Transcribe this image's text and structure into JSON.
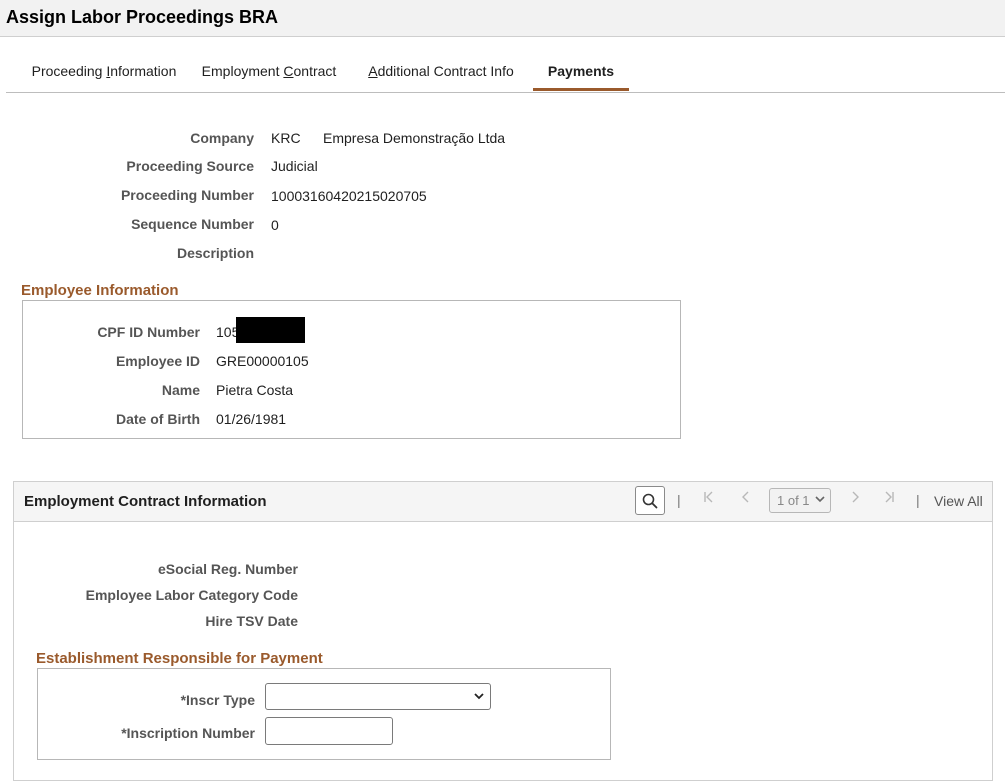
{
  "page": {
    "title": "Assign Labor Proceedings BRA"
  },
  "tabs": [
    {
      "label": "Proceeding Information",
      "accesskey_letter": "I",
      "active": false
    },
    {
      "label": "Employment Contract",
      "accesskey_letter": "C",
      "active": false
    },
    {
      "label": "Additional Contract Info",
      "accesskey_letter": "A",
      "active": false
    },
    {
      "label": "Payments",
      "active": true
    }
  ],
  "proceeding": {
    "company_label": "Company",
    "company_code": "KRC",
    "company_name": "Empresa Demonstração Ltda",
    "source_label": "Proceeding Source",
    "source_value": "Judicial",
    "number_label": "Proceeding Number",
    "number_value": "10003160420215020705",
    "sequence_label": "Sequence Number",
    "sequence_value": "0",
    "description_label": "Description",
    "description_value": ""
  },
  "employee": {
    "section_title": "Employee Information",
    "cpf_label": "CPF ID Number",
    "cpf_value_visible": "105",
    "employee_id_label": "Employee ID",
    "employee_id_value": "GRE00000105",
    "name_label": "Name",
    "name_value": "Pietra Costa",
    "dob_label": "Date of Birth",
    "dob_value": "01/26/1981"
  },
  "contract": {
    "section_title": "Employment Contract Information",
    "pager_text": "1 of 1",
    "view_all_label": "View All",
    "esocial_label": "eSocial Reg. Number",
    "labor_category_label": "Employee Labor Category Code",
    "hire_tsv_label": "Hire TSV Date"
  },
  "establishment": {
    "section_title": "Establishment Responsible for Payment",
    "inscr_type_label": "*Inscr Type",
    "inscr_type_value": "",
    "inscription_number_label": "*Inscription Number",
    "inscription_number_value": ""
  },
  "icons": {
    "search": "search-icon",
    "first": "first-page-icon",
    "prev": "previous-icon",
    "next": "next-icon",
    "last": "last-page-icon",
    "dropdown": "chevron-down-icon"
  },
  "colors": {
    "accent": "#9a5a2c",
    "label_gray": "#555555",
    "border": "#b7b7b7"
  }
}
